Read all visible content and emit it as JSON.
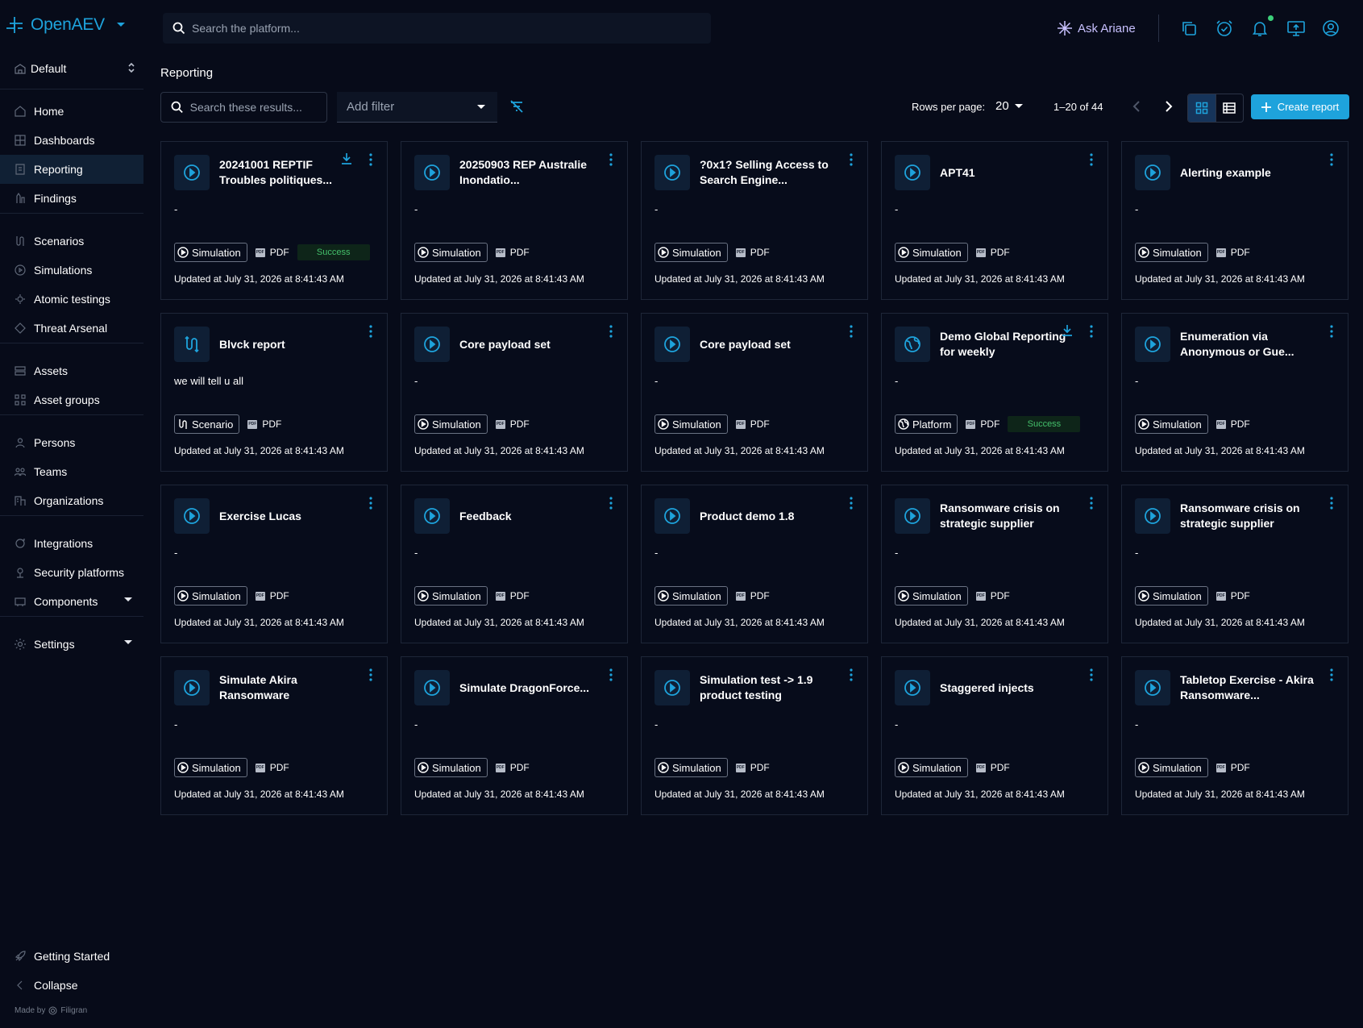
{
  "app": {
    "name": "OpenAEV"
  },
  "colors": {
    "accent": "#1ea3dc",
    "background": "#070b19",
    "success": "#44c06b",
    "ariane": "#c8c1ff"
  },
  "sidebar": {
    "workspace": "Default",
    "items": [
      {
        "label": "Home",
        "icon": "home-icon"
      },
      {
        "label": "Dashboards",
        "icon": "dashboard-icon"
      },
      {
        "label": "Reporting",
        "icon": "reporting-icon",
        "active": true
      },
      {
        "label": "Findings",
        "icon": "findings-icon"
      },
      {
        "label": "Scenarios",
        "icon": "scenarios-icon"
      },
      {
        "label": "Simulations",
        "icon": "simulations-icon"
      },
      {
        "label": "Atomic testings",
        "icon": "atomic-icon"
      },
      {
        "label": "Threat Arsenal",
        "icon": "arsenal-icon"
      },
      {
        "label": "Assets",
        "icon": "assets-icon"
      },
      {
        "label": "Asset groups",
        "icon": "asset-groups-icon"
      },
      {
        "label": "Persons",
        "icon": "person-icon"
      },
      {
        "label": "Teams",
        "icon": "teams-icon"
      },
      {
        "label": "Organizations",
        "icon": "organization-icon"
      },
      {
        "label": "Integrations",
        "icon": "integrations-icon"
      },
      {
        "label": "Security platforms",
        "icon": "security-platform-icon"
      },
      {
        "label": "Components",
        "icon": "components-icon",
        "expandable": true
      },
      {
        "label": "Settings",
        "icon": "settings-icon",
        "expandable": true
      }
    ],
    "footer": [
      {
        "label": "Getting Started",
        "icon": "rocket-icon"
      },
      {
        "label": "Collapse",
        "icon": "chevron-left-icon"
      }
    ],
    "made_by_prefix": "Made by",
    "made_by": "Filigran"
  },
  "topbar": {
    "search_placeholder": "Search the platform...",
    "ask_label": "Ask Ariane"
  },
  "toolbar": {
    "page_title": "Reporting",
    "search_placeholder": "Search these results...",
    "filter_placeholder": "Add filter",
    "rows_label": "Rows per page:",
    "rows_value": "20",
    "range": "1–20 of 44",
    "create_label": "Create report"
  },
  "cards": [
    {
      "title": "20241001 REPTIF Troubles politiques...",
      "desc": "-",
      "type": "Simulation",
      "format": "PDF",
      "status": "Success",
      "download": true,
      "updated": "Updated at July 31, 2026 at 8:41:43 AM"
    },
    {
      "title": "20250903 REP Australie Inondatio...",
      "desc": "-",
      "type": "Simulation",
      "format": "PDF",
      "status": "",
      "download": false,
      "updated": "Updated at July 31, 2026 at 8:41:43 AM"
    },
    {
      "title": "?0x1? Selling Access to Search Engine...",
      "desc": "-",
      "type": "Simulation",
      "format": "PDF",
      "status": "",
      "download": false,
      "updated": "Updated at July 31, 2026 at 8:41:43 AM"
    },
    {
      "title": "APT41",
      "desc": "-",
      "type": "Simulation",
      "format": "PDF",
      "status": "",
      "download": false,
      "updated": "Updated at July 31, 2026 at 8:41:43 AM"
    },
    {
      "title": "Alerting example",
      "desc": "-",
      "type": "Simulation",
      "format": "PDF",
      "status": "",
      "download": false,
      "updated": "Updated at July 31, 2026 at 8:41:43 AM"
    },
    {
      "title": "Blvck report",
      "desc": "we will tell u all",
      "type": "Scenario",
      "format": "PDF",
      "status": "",
      "download": false,
      "updated": "Updated at July 31, 2026 at 8:41:43 AM"
    },
    {
      "title": "Core payload set",
      "desc": "-",
      "type": "Simulation",
      "format": "PDF",
      "status": "",
      "download": false,
      "updated": "Updated at July 31, 2026 at 8:41:43 AM"
    },
    {
      "title": "Core payload set",
      "desc": "-",
      "type": "Simulation",
      "format": "PDF",
      "status": "",
      "download": false,
      "updated": "Updated at July 31, 2026 at 8:41:43 AM"
    },
    {
      "title": "Demo Global Reporting for weekly",
      "desc": "-",
      "type": "Platform",
      "format": "PDF",
      "status": "Success",
      "download": true,
      "updated": "Updated at July 31, 2026 at 8:41:43 AM"
    },
    {
      "title": "Enumeration via Anonymous or Gue...",
      "desc": "-",
      "type": "Simulation",
      "format": "PDF",
      "status": "",
      "download": false,
      "updated": "Updated at July 31, 2026 at 8:41:43 AM"
    },
    {
      "title": "Exercise Lucas",
      "desc": "-",
      "type": "Simulation",
      "format": "PDF",
      "status": "",
      "download": false,
      "updated": "Updated at July 31, 2026 at 8:41:43 AM"
    },
    {
      "title": "Feedback",
      "desc": "-",
      "type": "Simulation",
      "format": "PDF",
      "status": "",
      "download": false,
      "updated": "Updated at July 31, 2026 at 8:41:43 AM"
    },
    {
      "title": "Product demo 1.8",
      "desc": "-",
      "type": "Simulation",
      "format": "PDF",
      "status": "",
      "download": false,
      "updated": "Updated at July 31, 2026 at 8:41:43 AM"
    },
    {
      "title": "Ransomware crisis on strategic supplier",
      "desc": "-",
      "type": "Simulation",
      "format": "PDF",
      "status": "",
      "download": false,
      "updated": "Updated at July 31, 2026 at 8:41:43 AM"
    },
    {
      "title": "Ransomware crisis on strategic supplier",
      "desc": "-",
      "type": "Simulation",
      "format": "PDF",
      "status": "",
      "download": false,
      "updated": "Updated at July 31, 2026 at 8:41:43 AM"
    },
    {
      "title": "Simulate Akira Ransomware",
      "desc": "-",
      "type": "Simulation",
      "format": "PDF",
      "status": "",
      "download": false,
      "updated": "Updated at July 31, 2026 at 8:41:43 AM"
    },
    {
      "title": "Simulate DragonForce...",
      "desc": "-",
      "type": "Simulation",
      "format": "PDF",
      "status": "",
      "download": false,
      "updated": "Updated at July 31, 2026 at 8:41:43 AM"
    },
    {
      "title": "Simulation test -> 1.9 product testing",
      "desc": "-",
      "type": "Simulation",
      "format": "PDF",
      "status": "",
      "download": false,
      "updated": "Updated at July 31, 2026 at 8:41:43 AM"
    },
    {
      "title": "Staggered injects",
      "desc": "-",
      "type": "Simulation",
      "format": "PDF",
      "status": "",
      "download": false,
      "updated": "Updated at July 31, 2026 at 8:41:43 AM"
    },
    {
      "title": "Tabletop Exercise - Akira Ransomware...",
      "desc": "-",
      "type": "Simulation",
      "format": "PDF",
      "status": "",
      "download": false,
      "updated": "Updated at July 31, 2026 at 8:41:43 AM"
    }
  ]
}
